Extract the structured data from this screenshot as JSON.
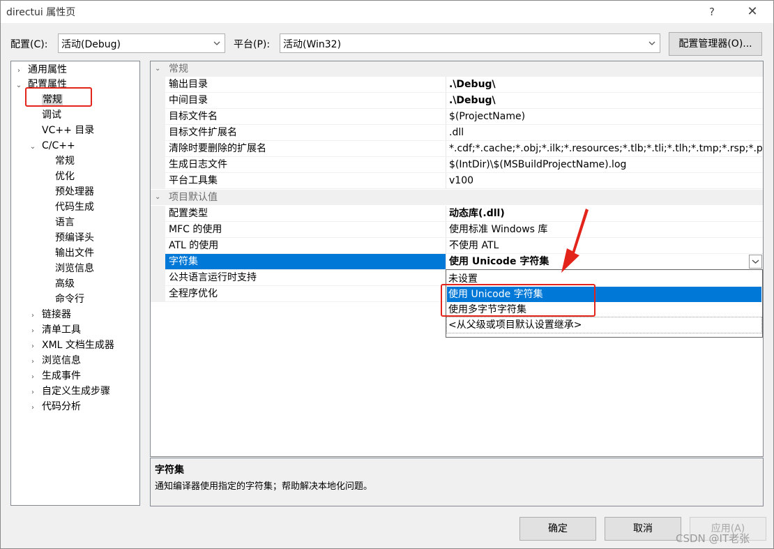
{
  "window": {
    "title": "directui 属性页",
    "help_label": "?",
    "close_label": "✕"
  },
  "toolbar": {
    "config_label": "配置(C):",
    "config_value": "活动(Debug)",
    "platform_label": "平台(P):",
    "platform_value": "活动(Win32)",
    "config_manager_label": "配置管理器(O)..."
  },
  "tree": {
    "items": [
      {
        "label": "通用属性",
        "twisty": "›"
      },
      {
        "label": "配置属性",
        "twisty": "⌄"
      },
      {
        "label": "常规"
      },
      {
        "label": "调试"
      },
      {
        "label": "VC++ 目录"
      },
      {
        "label": "C/C++",
        "twisty": "⌄"
      },
      {
        "label": "常规"
      },
      {
        "label": "优化"
      },
      {
        "label": "预处理器"
      },
      {
        "label": "代码生成"
      },
      {
        "label": "语言"
      },
      {
        "label": "预编译头"
      },
      {
        "label": "输出文件"
      },
      {
        "label": "浏览信息"
      },
      {
        "label": "高级"
      },
      {
        "label": "命令行"
      },
      {
        "label": "链接器",
        "twisty": "›"
      },
      {
        "label": "清单工具",
        "twisty": "›"
      },
      {
        "label": "XML 文档生成器",
        "twisty": "›"
      },
      {
        "label": "浏览信息",
        "twisty": "›"
      },
      {
        "label": "生成事件",
        "twisty": "›"
      },
      {
        "label": "自定义生成步骤",
        "twisty": "›"
      },
      {
        "label": "代码分析",
        "twisty": "›"
      }
    ]
  },
  "grid": {
    "categories": [
      {
        "label": "常规",
        "twisty": "⌄"
      },
      {
        "label": "项目默认值",
        "twisty": "⌄"
      }
    ],
    "general_rows": [
      {
        "name": "输出目录",
        "value": ".\\Debug\\"
      },
      {
        "name": "中间目录",
        "value": ".\\Debug\\"
      },
      {
        "name": "目标文件名",
        "value": "$(ProjectName)"
      },
      {
        "name": "目标文件扩展名",
        "value": ".dll"
      },
      {
        "name": "清除时要删除的扩展名",
        "value": "*.cdf;*.cache;*.obj;*.ilk;*.resources;*.tlb;*.tli;*.tlh;*.tmp;*.rsp;*.pgc;*.pgd;*.meta"
      },
      {
        "name": "生成日志文件",
        "value": "$(IntDir)\\$(MSBuildProjectName).log"
      },
      {
        "name": "平台工具集",
        "value": "v100"
      }
    ],
    "default_rows": [
      {
        "name": "配置类型",
        "value": "动态库(.dll)"
      },
      {
        "name": "MFC 的使用",
        "value": "使用标准 Windows 库"
      },
      {
        "name": "ATL 的使用",
        "value": "不使用 ATL"
      },
      {
        "name": "字符集",
        "value": "使用 Unicode 字符集"
      },
      {
        "name": "公共语言运行时支持",
        "value": ""
      },
      {
        "name": "全程序优化",
        "value": ""
      }
    ]
  },
  "dropdown": {
    "options": [
      "未设置",
      "使用 Unicode 字符集",
      "使用多字节字符集",
      "<从父级或项目默认设置继承>"
    ],
    "selected": "使用 Unicode 字符集"
  },
  "description": {
    "title": "字符集",
    "text": "通知编译器使用指定的字符集；帮助解决本地化问题。"
  },
  "buttons": {
    "ok": "确定",
    "cancel": "取消",
    "apply": "应用(A)"
  },
  "watermark": "CSDN @IT老张",
  "colors": {
    "selection": "#0078d7",
    "annotation_red": "#e3241b"
  }
}
